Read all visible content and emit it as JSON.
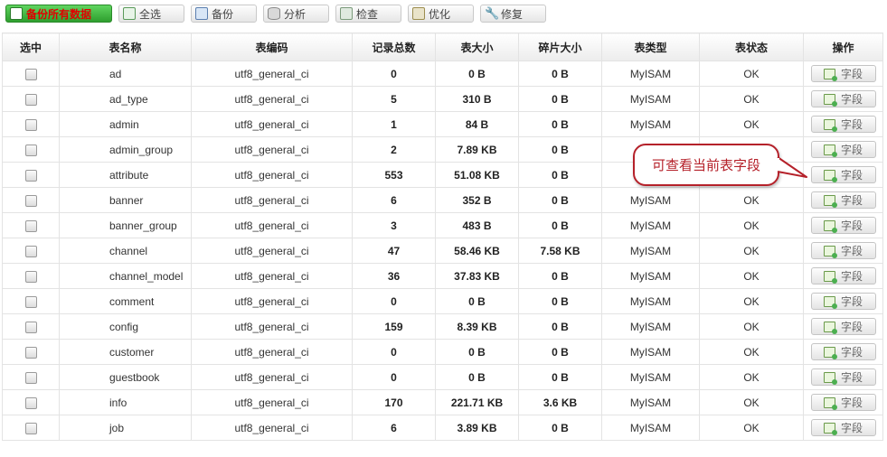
{
  "toolbar": {
    "backup_all": "备份所有数据",
    "select_all": "全选",
    "backup": "备份",
    "analyze": "分析",
    "check": "检查",
    "optimize": "优化",
    "repair": "修复"
  },
  "table": {
    "headers": [
      "选中",
      "表名称",
      "表编码",
      "记录总数",
      "表大小",
      "碎片大小",
      "表类型",
      "表状态",
      "操作"
    ],
    "rows": [
      {
        "name": "ad",
        "enc": "utf8_general_ci",
        "records": "0",
        "size": "0 B",
        "frag": "0 B",
        "type": "MyISAM",
        "status": "OK",
        "action": "字段"
      },
      {
        "name": "ad_type",
        "enc": "utf8_general_ci",
        "records": "5",
        "size": "310 B",
        "frag": "0 B",
        "type": "MyISAM",
        "status": "OK",
        "action": "字段"
      },
      {
        "name": "admin",
        "enc": "utf8_general_ci",
        "records": "1",
        "size": "84 B",
        "frag": "0 B",
        "type": "MyISAM",
        "status": "OK",
        "action": "字段"
      },
      {
        "name": "admin_group",
        "enc": "utf8_general_ci",
        "records": "2",
        "size": "7.89 KB",
        "frag": "0 B",
        "type": "",
        "status": "",
        "action": "字段"
      },
      {
        "name": "attribute",
        "enc": "utf8_general_ci",
        "records": "553",
        "size": "51.08 KB",
        "frag": "0 B",
        "type": "",
        "status": "",
        "action": "字段"
      },
      {
        "name": "banner",
        "enc": "utf8_general_ci",
        "records": "6",
        "size": "352 B",
        "frag": "0 B",
        "type": "MyISAM",
        "status": "OK",
        "action": "字段"
      },
      {
        "name": "banner_group",
        "enc": "utf8_general_ci",
        "records": "3",
        "size": "483 B",
        "frag": "0 B",
        "type": "MyISAM",
        "status": "OK",
        "action": "字段"
      },
      {
        "name": "channel",
        "enc": "utf8_general_ci",
        "records": "47",
        "size": "58.46 KB",
        "frag": "7.58 KB",
        "type": "MyISAM",
        "status": "OK",
        "action": "字段"
      },
      {
        "name": "channel_model",
        "enc": "utf8_general_ci",
        "records": "36",
        "size": "37.83 KB",
        "frag": "0 B",
        "type": "MyISAM",
        "status": "OK",
        "action": "字段"
      },
      {
        "name": "comment",
        "enc": "utf8_general_ci",
        "records": "0",
        "size": "0 B",
        "frag": "0 B",
        "type": "MyISAM",
        "status": "OK",
        "action": "字段"
      },
      {
        "name": "config",
        "enc": "utf8_general_ci",
        "records": "159",
        "size": "8.39 KB",
        "frag": "0 B",
        "type": "MyISAM",
        "status": "OK",
        "action": "字段"
      },
      {
        "name": "customer",
        "enc": "utf8_general_ci",
        "records": "0",
        "size": "0 B",
        "frag": "0 B",
        "type": "MyISAM",
        "status": "OK",
        "action": "字段"
      },
      {
        "name": "guestbook",
        "enc": "utf8_general_ci",
        "records": "0",
        "size": "0 B",
        "frag": "0 B",
        "type": "MyISAM",
        "status": "OK",
        "action": "字段"
      },
      {
        "name": "info",
        "enc": "utf8_general_ci",
        "records": "170",
        "size": "221.71 KB",
        "frag": "3.6 KB",
        "type": "MyISAM",
        "status": "OK",
        "action": "字段"
      },
      {
        "name": "job",
        "enc": "utf8_general_ci",
        "records": "6",
        "size": "3.89 KB",
        "frag": "0 B",
        "type": "MyISAM",
        "status": "OK",
        "action": "字段"
      }
    ]
  },
  "callout": {
    "text": "可查看当前表字段",
    "color": "#b5212a"
  },
  "icons": {
    "backup_all": "save-icon",
    "select_all": "checklist-icon",
    "backup": "disk-icon",
    "analyze": "database-icon",
    "check": "inspect-icon",
    "optimize": "basket-icon",
    "repair": "wrench-icon",
    "fields": "table-field-icon"
  }
}
